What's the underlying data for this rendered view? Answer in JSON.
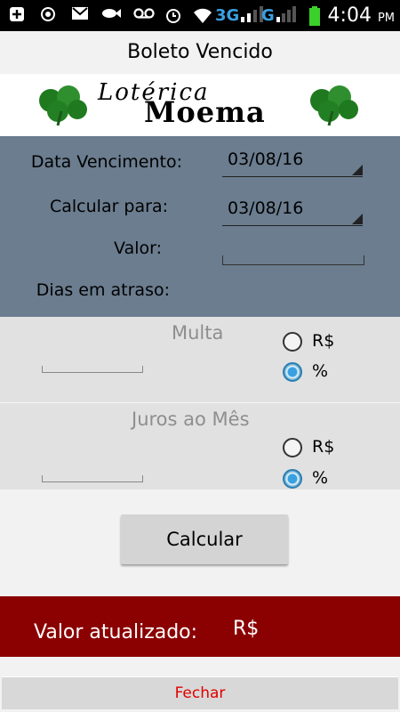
{
  "status_bar": {
    "icons": [
      "add-box-icon",
      "whatsapp-icon",
      "gmail-icon",
      "fish-icon",
      "voicemail-icon",
      "alarm-icon",
      "wifi-icon",
      "signal-3g-icon",
      "signal-g-icon",
      "battery-icon"
    ],
    "network_3g": "3G",
    "network_g": "G",
    "time": "4:04",
    "ampm": "PM"
  },
  "title": "Boleto Vencido",
  "logo": {
    "line1": "Lotérica",
    "line2": "Moema"
  },
  "form": {
    "data_vencimento_label": "Data Vencimento:",
    "data_vencimento_value": "03/08/16",
    "calcular_para_label": "Calcular para:",
    "calcular_para_value": "03/08/16",
    "valor_label": "Valor:",
    "dias_atraso_label": "Dias em atraso:"
  },
  "multa": {
    "title": "Multa",
    "option_currency": "R$",
    "option_percent": "%",
    "selected": "%"
  },
  "juros": {
    "title": "Juros ao Mês",
    "option_currency": "R$",
    "option_percent": "%",
    "selected": "%"
  },
  "calcular_button": "Calcular",
  "result": {
    "label": "Valor atualizado:",
    "currency": "R$"
  },
  "fechar_button": "Fechar",
  "colors": {
    "panel": "#6b7d8f",
    "result": "#8b0000",
    "fechar_text": "#e00000",
    "radio_selected": "#2a9ad8"
  }
}
